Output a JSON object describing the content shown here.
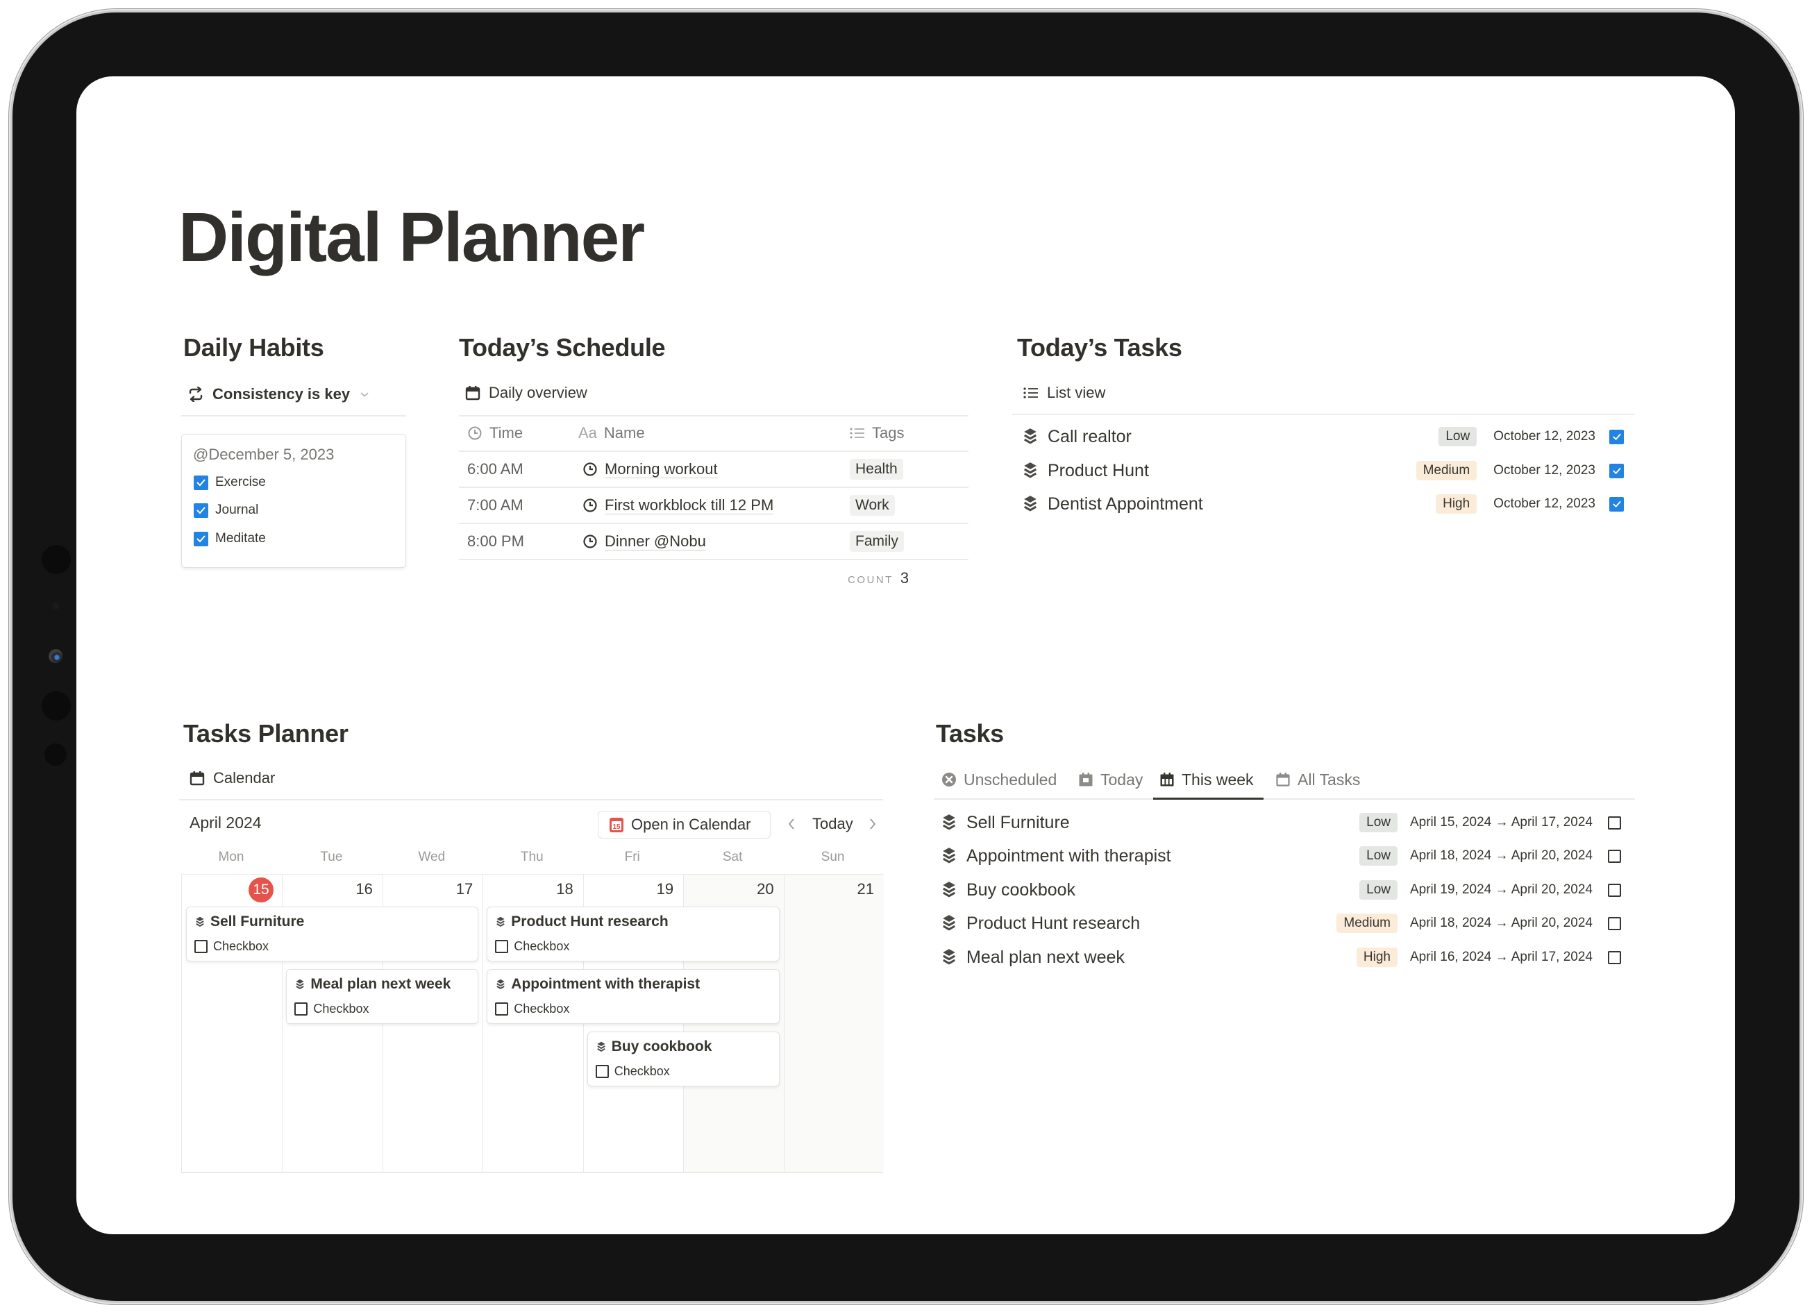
{
  "page": {
    "title": "Digital Planner"
  },
  "habits": {
    "heading": "Daily Habits",
    "view_label": "Consistency is key",
    "card": {
      "date": "@December 5, 2023",
      "items": [
        {
          "label": "Exercise",
          "checked": true
        },
        {
          "label": "Journal",
          "checked": true
        },
        {
          "label": "Meditate",
          "checked": true
        }
      ]
    }
  },
  "schedule": {
    "heading": "Today’s Schedule",
    "view_label": "Daily overview",
    "columns": {
      "time": "Time",
      "name_prefix": "Aa",
      "name": "Name",
      "tags": "Tags"
    },
    "rows": [
      {
        "time": "6:00 AM",
        "name": "Morning workout",
        "tag": "Health"
      },
      {
        "time": "7:00 AM",
        "name": "First workblock till 12 PM",
        "tag": "Work"
      },
      {
        "time": "8:00 PM",
        "name": "Dinner @Nobu",
        "tag": "Family"
      }
    ],
    "count_label": "COUNT",
    "count_value": "3"
  },
  "today_tasks": {
    "heading": "Today’s Tasks",
    "view_label": "List view",
    "rows": [
      {
        "name": "Call realtor",
        "priority": "Low",
        "date": "October 12, 2023",
        "done": true
      },
      {
        "name": "Product Hunt",
        "priority": "Medium",
        "date": "October 12, 2023",
        "done": true
      },
      {
        "name": "Dentist Appointment",
        "priority": "High",
        "date": "October 12, 2023",
        "done": true
      }
    ]
  },
  "planner": {
    "heading": "Tasks Planner",
    "view_label": "Calendar",
    "month": "April 2024",
    "open_in_calendar": "Open in Calendar",
    "open_icon_day": "15",
    "today_label": "Today",
    "weekdays": [
      "Mon",
      "Tue",
      "Wed",
      "Thu",
      "Fri",
      "Sat",
      "Sun"
    ],
    "days": [
      "15",
      "16",
      "17",
      "18",
      "19",
      "20",
      "21"
    ],
    "today_day": "15",
    "events": [
      {
        "title": "Sell Furniture",
        "checkbox_label": "Checkbox",
        "checked": false
      },
      {
        "title": "Meal plan next week",
        "checkbox_label": "Checkbox",
        "checked": false
      },
      {
        "title": "Product Hunt research",
        "checkbox_label": "Checkbox",
        "checked": false
      },
      {
        "title": "Appointment with therapist",
        "checkbox_label": "Checkbox",
        "checked": false
      },
      {
        "title": "Buy cookbook",
        "checkbox_label": "Checkbox",
        "checked": false
      }
    ]
  },
  "tasks": {
    "heading": "Tasks",
    "tabs": [
      {
        "label": "Unscheduled",
        "icon": "x-circle-icon"
      },
      {
        "label": "Today",
        "icon": "calendar-day-icon"
      },
      {
        "label": "This week",
        "icon": "calendar-week-icon",
        "active": true
      },
      {
        "label": "All Tasks",
        "icon": "calendar-icon"
      }
    ],
    "rows": [
      {
        "name": "Sell Furniture",
        "priority": "Low",
        "date": "April 15, 2024 → April 17, 2024",
        "done": false
      },
      {
        "name": "Appointment with therapist",
        "priority": "Low",
        "date": "April 18, 2024 → April 20, 2024",
        "done": false
      },
      {
        "name": "Buy cookbook",
        "priority": "Low",
        "date": "April 19, 2024 → April 20, 2024",
        "done": false
      },
      {
        "name": "Product Hunt research",
        "priority": "Medium",
        "date": "April 18, 2024 → April 20, 2024",
        "done": false
      },
      {
        "name": "Meal plan next week",
        "priority": "High",
        "date": "April 16, 2024 → April 17, 2024",
        "done": false
      }
    ]
  },
  "colors": {
    "text": "#37352f",
    "checkbox_blue": "#2383e2",
    "priority_low": "#e3e6e3",
    "priority_medium_high": "#fbecd9",
    "today_badge": "#e5534b",
    "tag_gray": "#f1f1ef"
  }
}
